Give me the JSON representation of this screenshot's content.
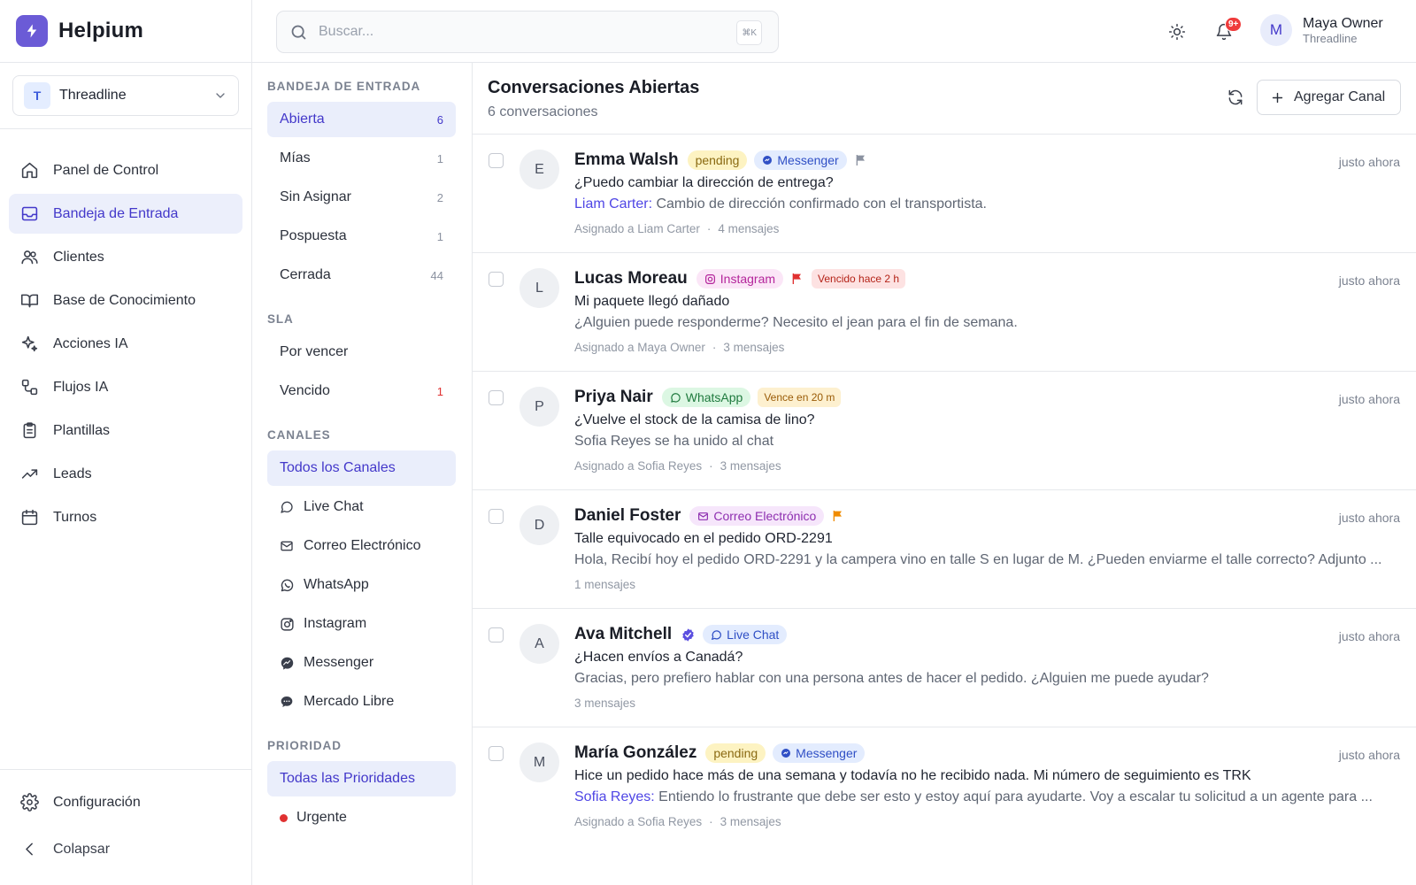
{
  "brand": {
    "name": "Helpium"
  },
  "workspace": {
    "initial": "T",
    "name": "Threadline"
  },
  "nav": [
    {
      "label": "Panel de Control",
      "icon": "home-icon",
      "active": false
    },
    {
      "label": "Bandeja de Entrada",
      "icon": "inbox-icon",
      "active": true
    },
    {
      "label": "Clientes",
      "icon": "users-icon",
      "active": false
    },
    {
      "label": "Base de Conocimiento",
      "icon": "book-icon",
      "active": false
    },
    {
      "label": "Acciones IA",
      "icon": "sparkles-icon",
      "active": false
    },
    {
      "label": "Flujos IA",
      "icon": "workflow-icon",
      "active": false
    },
    {
      "label": "Plantillas",
      "icon": "clipboard-icon",
      "active": false
    },
    {
      "label": "Leads",
      "icon": "trending-up-icon",
      "active": false
    },
    {
      "label": "Turnos",
      "icon": "calendar-icon",
      "active": false
    }
  ],
  "sidebar_bottom": {
    "settings": "Configuración",
    "collapse": "Colapsar"
  },
  "topbar": {
    "search_placeholder": "Buscar...",
    "shortcut": "⌘K",
    "notifications_badge": "9+",
    "user": {
      "initial": "M",
      "name": "Maya Owner",
      "org": "Threadline"
    }
  },
  "filters": {
    "inbox_title": "BANDEJA DE ENTRADA",
    "inbox": [
      {
        "label": "Abierta",
        "count": "6"
      },
      {
        "label": "Mías",
        "count": "1"
      },
      {
        "label": "Sin Asignar",
        "count": "2"
      },
      {
        "label": "Pospuesta",
        "count": "1"
      },
      {
        "label": "Cerrada",
        "count": "44"
      }
    ],
    "sla_title": "SLA",
    "sla": [
      {
        "label": "Por vencer",
        "count": ""
      },
      {
        "label": "Vencido",
        "count": "1"
      }
    ],
    "channels_title": "CANALES",
    "channels": [
      {
        "label": "Todos los Canales"
      },
      {
        "label": "Live Chat"
      },
      {
        "label": "Correo Electrónico"
      },
      {
        "label": "WhatsApp"
      },
      {
        "label": "Instagram"
      },
      {
        "label": "Messenger"
      },
      {
        "label": "Mercado Libre"
      }
    ],
    "priority_title": "PRIORIDAD",
    "priority": [
      {
        "label": "Todas las Prioridades"
      },
      {
        "label": "Urgente"
      }
    ]
  },
  "main": {
    "title": "Conversaciones Abiertas",
    "subtitle": "6 conversaciones",
    "add_channel": "Agregar Canal"
  },
  "conversations": [
    {
      "initial": "E",
      "name": "Emma Walsh",
      "status": "pending",
      "channel": "Messenger",
      "flag_color": "#8b92a0",
      "sla": "",
      "time": "justo ahora",
      "subject": "¿Puedo cambiar la dirección de entrega?",
      "preview_author": "Liam Carter:",
      "preview": " Cambio de dirección confirmado con el transportista.",
      "assigned": "Asignado a Liam Carter",
      "messages": "4 mensajes"
    },
    {
      "initial": "L",
      "name": "Lucas Moreau",
      "status": "",
      "channel": "Instagram",
      "flag_color": "#e03131",
      "sla": "Vencido hace 2 h",
      "time": "justo ahora",
      "subject": "Mi paquete llegó dañado",
      "preview_author": "",
      "preview": "¿Alguien puede responderme? Necesito el jean para el fin de semana.",
      "assigned": "Asignado a Maya Owner",
      "messages": "3 mensajes"
    },
    {
      "initial": "P",
      "name": "Priya Nair",
      "status": "",
      "channel": "WhatsApp",
      "flag_color": "",
      "sla": "Vence en 20 m",
      "time": "justo ahora",
      "subject": "¿Vuelve el stock de la camisa de lino?",
      "preview_author": "",
      "preview": "Sofia Reyes se ha unido al chat",
      "assigned": "Asignado a Sofia Reyes",
      "messages": "3 mensajes"
    },
    {
      "initial": "D",
      "name": "Daniel Foster",
      "status": "",
      "channel": "Correo Electrónico",
      "flag_color": "#f08c00",
      "sla": "",
      "time": "justo ahora",
      "subject": "Talle equivocado en el pedido ORD-2291",
      "preview_author": "",
      "preview": "Hola, Recibí hoy el pedido ORD-2291 y la campera vino en talle S en lugar de M. ¿Pueden enviarme el talle correcto? Adjunto ...",
      "assigned": "",
      "messages": "1 mensajes"
    },
    {
      "initial": "A",
      "name": "Ava Mitchell",
      "status": "",
      "channel": "Live Chat",
      "flag_color": "",
      "sla": "",
      "verified": true,
      "time": "justo ahora",
      "subject": "¿Hacen envíos a Canadá?",
      "preview_author": "",
      "preview": "Gracias, pero prefiero hablar con una persona antes de hacer el pedido. ¿Alguien me puede ayudar?",
      "assigned": "",
      "messages": "3 mensajes"
    },
    {
      "initial": "M",
      "name": "María González",
      "status": "pending",
      "channel": "Messenger",
      "flag_color": "",
      "sla": "",
      "time": "justo ahora",
      "subject": "Hice un pedido hace más de una semana y todavía no he recibido nada. Mi número de seguimiento es TRK",
      "preview_author": "Sofia Reyes:",
      "preview": " Entiendo lo frustrante que debe ser esto y estoy aquí para ayudarte. Voy a escalar tu solicitud a un agente para ...",
      "assigned": "Asignado a Sofia Reyes",
      "messages": "3 mensajes"
    }
  ],
  "colors": {
    "accent": "#4338ca",
    "brand": "#6b5bd6",
    "danger": "#e03131"
  }
}
